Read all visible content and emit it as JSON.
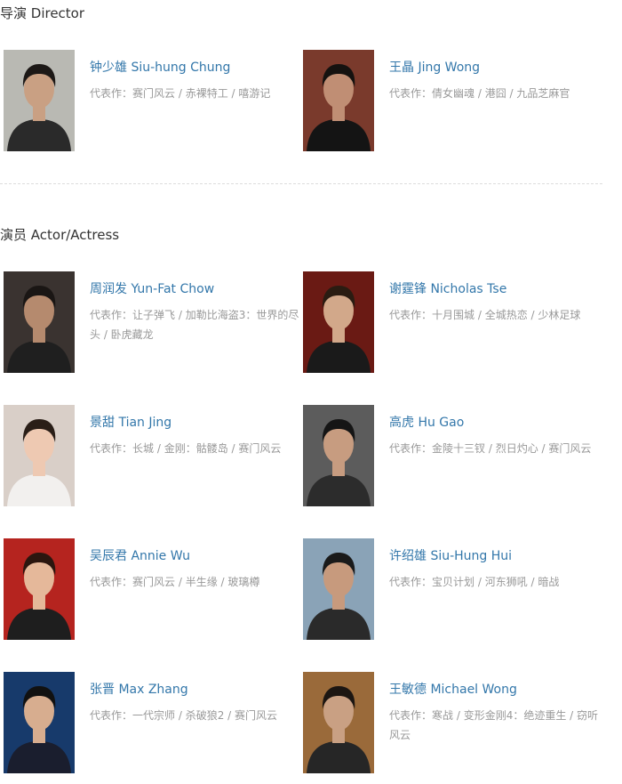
{
  "director_section": {
    "title": "导演 Director"
  },
  "actor_section": {
    "title": "演员 Actor/Actress"
  },
  "works_prefix": "代表作：",
  "directors": [
    {
      "name": "钟少雄 Siu-hung Chung",
      "works": "赛门风云 / 赤裸特工 / 嘻游记",
      "photo_bg": "#b9b9b3",
      "skin": "#c9a083",
      "hair": "#1c1816",
      "shirt": "#2a2a2a"
    },
    {
      "name": "王晶 Jing Wong",
      "works": "倩女幽魂 / 港囧 / 九品芝麻官",
      "photo_bg": "#7a3a2c",
      "skin": "#c08e74",
      "hair": "#151210",
      "shirt": "#141414"
    }
  ],
  "actors": [
    {
      "name": "周润发 Yun-Fat Chow",
      "works": "让子弹飞 / 加勒比海盗3：世界的尽头 / 卧虎藏龙",
      "photo_bg": "#3a3330",
      "skin": "#b58a6e",
      "hair": "#1a1614",
      "shirt": "#1f1f1f"
    },
    {
      "name": "谢霆锋 Nicholas Tse",
      "works": "十月围城 / 全城热恋 / 少林足球",
      "photo_bg": "#6a1a14",
      "skin": "#d2a88a",
      "hair": "#2a1c12",
      "shirt": "#1a1a1a"
    },
    {
      "name": "景甜 Tian Jing",
      "works": "长城 / 金刚：骷髅岛 / 赛门风云",
      "photo_bg": "#d9cfc8",
      "skin": "#eec9b2",
      "hair": "#2a1e17",
      "shirt": "#f2f0ee"
    },
    {
      "name": "高虎 Hu Gao",
      "works": "金陵十三钗 / 烈日灼心 / 赛门风云",
      "photo_bg": "#5c5c5c",
      "skin": "#c79c80",
      "hair": "#151515",
      "shirt": "#2c2c2c"
    },
    {
      "name": "吴辰君 Annie Wu",
      "works": "赛门风云 / 半生缘 / 玻璃樽",
      "photo_bg": "#b5241f",
      "skin": "#e5b89a",
      "hair": "#2b160f",
      "shirt": "#1e1e1e"
    },
    {
      "name": "许绍雄 Siu-Hung Hui",
      "works": "宝贝计划 / 河东狮吼 / 暗战",
      "photo_bg": "#8aa3b7",
      "skin": "#c79a7d",
      "hair": "#1a1a1a",
      "shirt": "#2a2a2a"
    },
    {
      "name": "张晋 Max Zhang",
      "works": "一代宗师 / 杀破狼2 / 赛门风云",
      "photo_bg": "#173a6b",
      "skin": "#d7ad8f",
      "hair": "#111111",
      "shirt": "#1a1e2e"
    },
    {
      "name": "王敏德 Michael Wong",
      "works": "寒战 / 变形金刚4：绝迹重生 / 窃听风云",
      "photo_bg": "#9a6a3a",
      "skin": "#c9a083",
      "hair": "#1c1612",
      "shirt": "#262626"
    }
  ]
}
